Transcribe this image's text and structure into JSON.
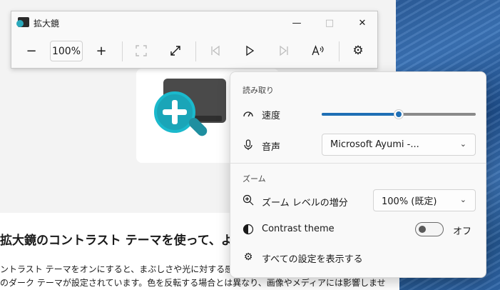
{
  "window": {
    "title": "拡大鏡",
    "minimize_icon": "minimize-icon",
    "maximize_icon": "maximize-icon",
    "close_icon": "close-icon"
  },
  "toolbar": {
    "zoom_out_icon": "minus-icon",
    "zoom_level": "100%",
    "zoom_in_icon": "plus-icon",
    "fit_icon": "fit-view-icon",
    "fullscreen_icon": "expand-icon",
    "prev_icon": "skip-previous-icon",
    "play_icon": "play-icon",
    "next_icon": "skip-next-icon",
    "read_icon": "read-aloud-icon",
    "settings_icon": "gear-icon"
  },
  "background": {
    "article_heading": "拡大鏡のコントラスト テーマを使って、より快",
    "article_line1": "ントラスト テーマをオンにすると、まぶしさや光に対する感度を",
    "article_line2": "のダーク テーマが設定されています。色を反転する場合とは異なり、画像やメディアには影響しません。"
  },
  "settings": {
    "reading_section": "読み取り",
    "speed_label": "速度",
    "speed_level": 0.5,
    "voice_label": "音声",
    "voice_value": "Microsoft Ayumi -...",
    "zoom_section": "ズーム",
    "zoom_increment_label": "ズーム レベルの増分",
    "zoom_increment_value": "100% (既定)",
    "contrast_label": "Contrast theme",
    "contrast_state": "オフ",
    "all_settings_label": "すべての設定を表示する"
  },
  "colors": {
    "accent": "#1f6fb5",
    "hero_lens": "#1aa5b8"
  }
}
